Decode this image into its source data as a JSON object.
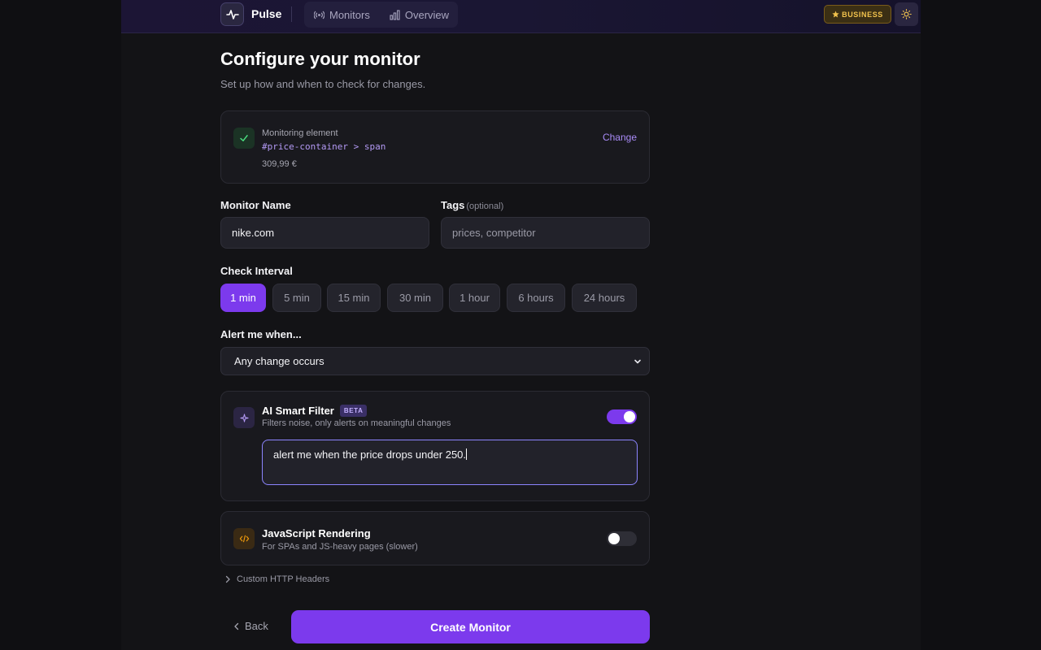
{
  "header": {
    "brand": "Pulse",
    "nav": [
      {
        "label": "Monitors",
        "icon": "broadcast-icon"
      },
      {
        "label": "Overview",
        "icon": "bar-chart-icon"
      }
    ],
    "plan_badge": "BUSINESS",
    "plan_icon": "star-icon",
    "theme_icon": "sun-icon"
  },
  "page": {
    "title": "Configure your monitor",
    "subtitle": "Set up how and when to check for changes."
  },
  "element_card": {
    "label": "Monitoring element",
    "selector": "#price-container > span",
    "value": "309,99 €",
    "change_label": "Change"
  },
  "form": {
    "name": {
      "label": "Monitor Name",
      "value": "nike.com"
    },
    "tags": {
      "label": "Tags",
      "optional": "(optional)",
      "placeholder": "prices, competitor"
    },
    "interval": {
      "label": "Check Interval",
      "options": [
        "1 min",
        "5 min",
        "15 min",
        "30 min",
        "1 hour",
        "6 hours",
        "24 hours"
      ],
      "selected": "1 min"
    },
    "alert": {
      "label": "Alert me when...",
      "selected": "Any change occurs"
    }
  },
  "ai_filter": {
    "title": "AI Smart Filter",
    "badge": "BETA",
    "description": "Filters noise, only alerts on meaningful changes",
    "enabled": true,
    "prompt": "alert me when the price drops under 250."
  },
  "js_rendering": {
    "title": "JavaScript Rendering",
    "description": "For SPAs and JS-heavy pages (slower)",
    "enabled": false
  },
  "advanced": {
    "label": "Custom HTTP Headers"
  },
  "actions": {
    "back": "Back",
    "create": "Create Monitor"
  },
  "colors": {
    "accent": "#7c3aed",
    "success": "#4ade80",
    "badge_gold": "#f1c24d"
  }
}
